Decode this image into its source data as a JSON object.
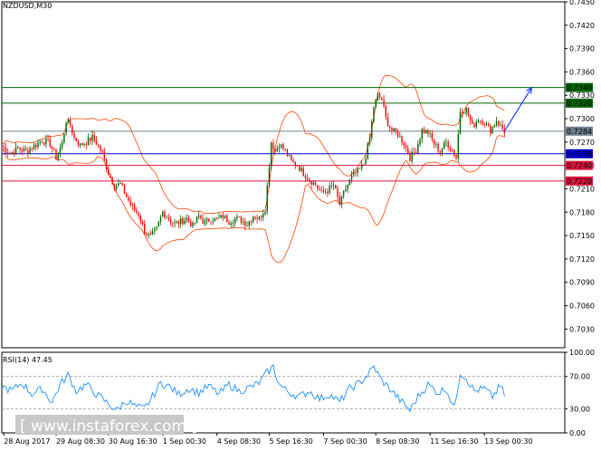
{
  "chart_data": {
    "type": "candlestick",
    "title": "NZDUSD,M30",
    "ylim": [
      0.7006,
      0.745
    ],
    "y_ticks": [
      "0.7450",
      "0.7420",
      "0.7390",
      "0.7360",
      "0.7330",
      "0.7300",
      "0.7270",
      "0.7240",
      "0.7210",
      "0.7180",
      "0.7150",
      "0.7120",
      "0.7090",
      "0.7060",
      "0.7030"
    ],
    "x_ticks": [
      "28 Aug 2017",
      "29 Aug 08:30",
      "30 Aug 16:30",
      "1 Sep 00:30",
      "4 Sep 08:30",
      "5 Sep 16:30",
      "7 Sep 00:30",
      "8 Sep 08:30",
      "11 Sep 16:30",
      "13 Sep 00:30"
    ],
    "price_path": [
      [
        0,
        0.7265
      ],
      [
        8,
        0.7255
      ],
      [
        16,
        0.7262
      ],
      [
        24,
        0.7258
      ],
      [
        32,
        0.7265
      ],
      [
        40,
        0.7272
      ],
      [
        48,
        0.7268
      ],
      [
        54,
        0.725
      ],
      [
        60,
        0.7268
      ],
      [
        64,
        0.7298
      ],
      [
        68,
        0.7292
      ],
      [
        72,
        0.7275
      ],
      [
        78,
        0.7266
      ],
      [
        84,
        0.727
      ],
      [
        90,
        0.7276
      ],
      [
        96,
        0.7265
      ],
      [
        100,
        0.7255
      ],
      [
        106,
        0.723
      ],
      [
        112,
        0.7214
      ],
      [
        118,
        0.7216
      ],
      [
        124,
        0.72
      ],
      [
        130,
        0.7185
      ],
      [
        136,
        0.7178
      ],
      [
        142,
        0.7155
      ],
      [
        148,
        0.7148
      ],
      [
        154,
        0.7158
      ],
      [
        160,
        0.718
      ],
      [
        166,
        0.7172
      ],
      [
        172,
        0.7165
      ],
      [
        178,
        0.7168
      ],
      [
        184,
        0.7172
      ],
      [
        190,
        0.7162
      ],
      [
        196,
        0.7175
      ],
      [
        202,
        0.7166
      ],
      [
        208,
        0.7172
      ],
      [
        214,
        0.717
      ],
      [
        220,
        0.7175
      ],
      [
        226,
        0.7168
      ],
      [
        232,
        0.7172
      ],
      [
        238,
        0.717
      ],
      [
        244,
        0.7165
      ],
      [
        250,
        0.7175
      ],
      [
        256,
        0.7172
      ],
      [
        262,
        0.7185
      ],
      [
        268,
        0.727
      ],
      [
        272,
        0.7258
      ],
      [
        276,
        0.7268
      ],
      [
        282,
        0.7258
      ],
      [
        288,
        0.7245
      ],
      [
        294,
        0.724
      ],
      [
        300,
        0.723
      ],
      [
        306,
        0.7222
      ],
      [
        312,
        0.7215
      ],
      [
        318,
        0.7205
      ],
      [
        324,
        0.7208
      ],
      [
        330,
        0.7215
      ],
      [
        336,
        0.719
      ],
      [
        342,
        0.721
      ],
      [
        348,
        0.7225
      ],
      [
        354,
        0.7232
      ],
      [
        360,
        0.7242
      ],
      [
        366,
        0.7275
      ],
      [
        370,
        0.7315
      ],
      [
        374,
        0.733
      ],
      [
        378,
        0.7325
      ],
      [
        382,
        0.73
      ],
      [
        388,
        0.7285
      ],
      [
        394,
        0.728
      ],
      [
        400,
        0.7268
      ],
      [
        406,
        0.725
      ],
      [
        412,
        0.726
      ],
      [
        418,
        0.7285
      ],
      [
        424,
        0.7282
      ],
      [
        430,
        0.7268
      ],
      [
        436,
        0.7258
      ],
      [
        442,
        0.727
      ],
      [
        448,
        0.726
      ],
      [
        452,
        0.725
      ],
      [
        456,
        0.731
      ],
      [
        462,
        0.7312
      ],
      [
        468,
        0.729
      ],
      [
        474,
        0.73
      ],
      [
        480,
        0.7295
      ],
      [
        486,
        0.7285
      ],
      [
        492,
        0.7298
      ],
      [
        496,
        0.729
      ],
      [
        500,
        0.7284
      ]
    ],
    "forecast_arrow": {
      "from": [
        500,
        0.7284
      ],
      "to": [
        527,
        0.734
      ]
    },
    "levels": [
      {
        "value": 0.734,
        "label": "0.7340",
        "color": "#006400",
        "label_bg": "#006400"
      },
      {
        "value": 0.732,
        "label": "0.7320",
        "color": "#006400",
        "label_bg": "#006400"
      },
      {
        "value": 0.7284,
        "label": "0.7284",
        "color": "#708090",
        "label_bg": "#708090"
      },
      {
        "value": 0.7255,
        "label": "0.7255",
        "color": "#0000cd",
        "label_bg": "#0000cd"
      },
      {
        "value": 0.724,
        "label": "0.7240",
        "color": "#dc143c",
        "label_bg": "#dc143c"
      },
      {
        "value": 0.722,
        "label": "0.7220",
        "color": "#dc143c",
        "label_bg": "#dc143c"
      }
    ],
    "rsi": {
      "title": "RSI(14) 47.45",
      "ylim": [
        0,
        100
      ],
      "y_ticks": [
        "100.00",
        "70.00",
        "30.00",
        "0.00"
      ],
      "levels": [
        70,
        30
      ],
      "path": [
        [
          0,
          58
        ],
        [
          10,
          52
        ],
        [
          20,
          62
        ],
        [
          30,
          48
        ],
        [
          40,
          55
        ],
        [
          50,
          38
        ],
        [
          58,
          60
        ],
        [
          66,
          72
        ],
        [
          74,
          52
        ],
        [
          84,
          60
        ],
        [
          94,
          48
        ],
        [
          104,
          38
        ],
        [
          114,
          28
        ],
        [
          124,
          40
        ],
        [
          134,
          32
        ],
        [
          142,
          30
        ],
        [
          150,
          45
        ],
        [
          158,
          62
        ],
        [
          166,
          58
        ],
        [
          176,
          48
        ],
        [
          186,
          55
        ],
        [
          196,
          50
        ],
        [
          206,
          58
        ],
        [
          216,
          48
        ],
        [
          226,
          60
        ],
        [
          236,
          52
        ],
        [
          246,
          56
        ],
        [
          256,
          62
        ],
        [
          264,
          75
        ],
        [
          270,
          82
        ],
        [
          276,
          60
        ],
        [
          286,
          50
        ],
        [
          296,
          45
        ],
        [
          306,
          52
        ],
        [
          316,
          42
        ],
        [
          326,
          48
        ],
        [
          336,
          38
        ],
        [
          346,
          55
        ],
        [
          356,
          62
        ],
        [
          364,
          72
        ],
        [
          370,
          82
        ],
        [
          378,
          65
        ],
        [
          388,
          52
        ],
        [
          398,
          38
        ],
        [
          406,
          28
        ],
        [
          414,
          45
        ],
        [
          424,
          60
        ],
        [
          434,
          50
        ],
        [
          442,
          55
        ],
        [
          450,
          30
        ],
        [
          456,
          75
        ],
        [
          462,
          68
        ],
        [
          470,
          52
        ],
        [
          480,
          55
        ],
        [
          488,
          45
        ],
        [
          496,
          58
        ],
        [
          500,
          47
        ]
      ]
    },
    "colors": {
      "bull": "#006400",
      "bear": "#ff0000",
      "bands": "#ff4500",
      "rsi_line": "#1e90ff",
      "arrow": "#1e3cff"
    }
  },
  "watermark": {
    "text": "[  www.instaforex.com  ]",
    "bg": "#c8c8c8"
  }
}
